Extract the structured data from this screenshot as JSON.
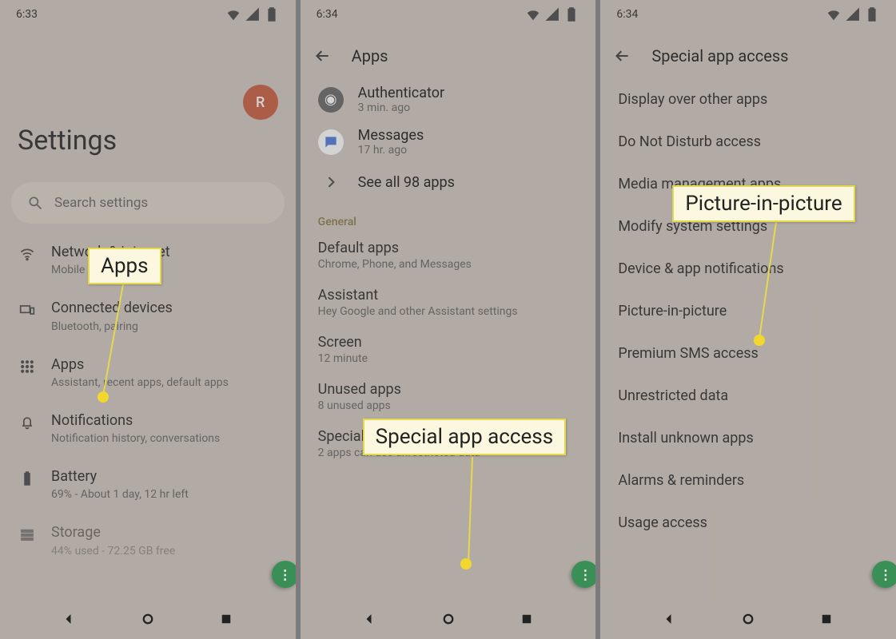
{
  "panel1": {
    "time": "6:33",
    "avatar_letter": "R",
    "title": "Settings",
    "search_placeholder": "Search settings",
    "rows": [
      {
        "icon": "wifi",
        "title": "Network & internet",
        "sub": "Mobile"
      },
      {
        "icon": "devices",
        "title": "Connected devices",
        "sub": "Bluetooth, pairing"
      },
      {
        "icon": "apps",
        "title": "Apps",
        "sub": "Assistant, recent apps, default apps"
      },
      {
        "icon": "bell",
        "title": "Notifications",
        "sub": "Notification history, conversations"
      },
      {
        "icon": "battery",
        "title": "Battery",
        "sub": "69% - About 1 day, 12 hr left"
      },
      {
        "icon": "storage",
        "title": "Storage",
        "sub": "44% used - 72.25 GB free"
      }
    ],
    "callout": "Apps"
  },
  "panel2": {
    "time": "6:34",
    "header": "Apps",
    "recent": [
      {
        "name": "Authenticator",
        "sub": "3 min. ago",
        "color": "#444"
      },
      {
        "name": "Messages",
        "sub": "17 hr. ago",
        "color": "#3a6bd8"
      }
    ],
    "see_all": "See all 98 apps",
    "section_label": "General",
    "general_rows": [
      {
        "title": "Default apps",
        "sub": "Chrome, Phone, and Messages"
      },
      {
        "title": "Assistant",
        "sub": "Hey Google and other Assistant settings"
      },
      {
        "title": "Screen",
        "sub": "12 minute"
      },
      {
        "title": "Unused apps",
        "sub": "8 unused apps"
      },
      {
        "title": "Special app access",
        "sub": "2 apps can use unrestricted data"
      }
    ],
    "callout": "Special app access"
  },
  "panel3": {
    "time": "6:34",
    "header": "Special app access",
    "rows": [
      "Display over other apps",
      "Do Not Disturb access",
      "Media management apps",
      "Modify system settings",
      "Device & app notifications",
      "Picture-in-picture",
      "Premium SMS access",
      "Unrestricted data",
      "Install unknown apps",
      "Alarms & reminders",
      "Usage access"
    ],
    "callout": "Picture-in-picture"
  }
}
